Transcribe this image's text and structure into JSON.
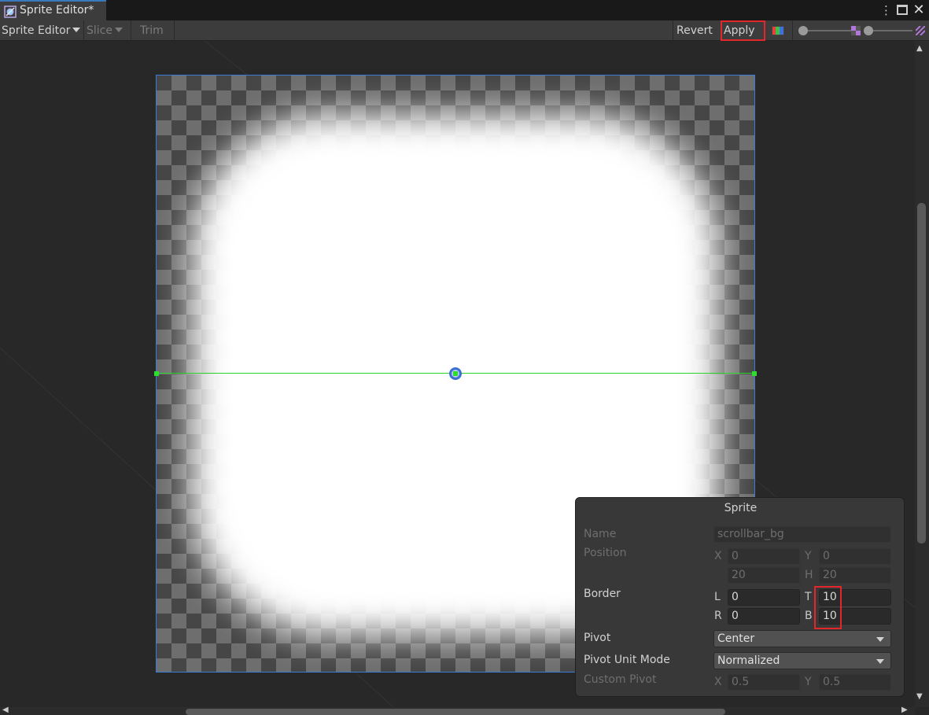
{
  "window": {
    "tab_title": "Sprite Editor*"
  },
  "toolbar": {
    "mode_label": "Sprite Editor",
    "slice_label": "Slice",
    "trim_label": "Trim",
    "revert_label": "Revert",
    "apply_label": "Apply"
  },
  "sprite_panel": {
    "title": "Sprite",
    "name_label": "Name",
    "name_value": "scrollbar_bg",
    "position_label": "Position",
    "position": {
      "x_label": "X",
      "x": "0",
      "y_label": "Y",
      "y": "0",
      "w": "20",
      "h_label": "H",
      "h": "20"
    },
    "border_label": "Border",
    "border": {
      "l_label": "L",
      "l": "0",
      "t_label": "T",
      "t": "10",
      "r_label": "R",
      "r": "0",
      "b_label": "B",
      "b": "10"
    },
    "pivot_label": "Pivot",
    "pivot_value": "Center",
    "pivot_unit_label": "Pivot Unit Mode",
    "pivot_unit_value": "Normalized",
    "custom_pivot_label": "Custom Pivot",
    "custom_pivot": {
      "x_label": "X",
      "x": "0.5",
      "y_label": "Y",
      "y": "0.5"
    }
  },
  "colors": {
    "highlight": "#e2262a",
    "border_line": "#28d428",
    "selection": "#3a7bd5"
  }
}
